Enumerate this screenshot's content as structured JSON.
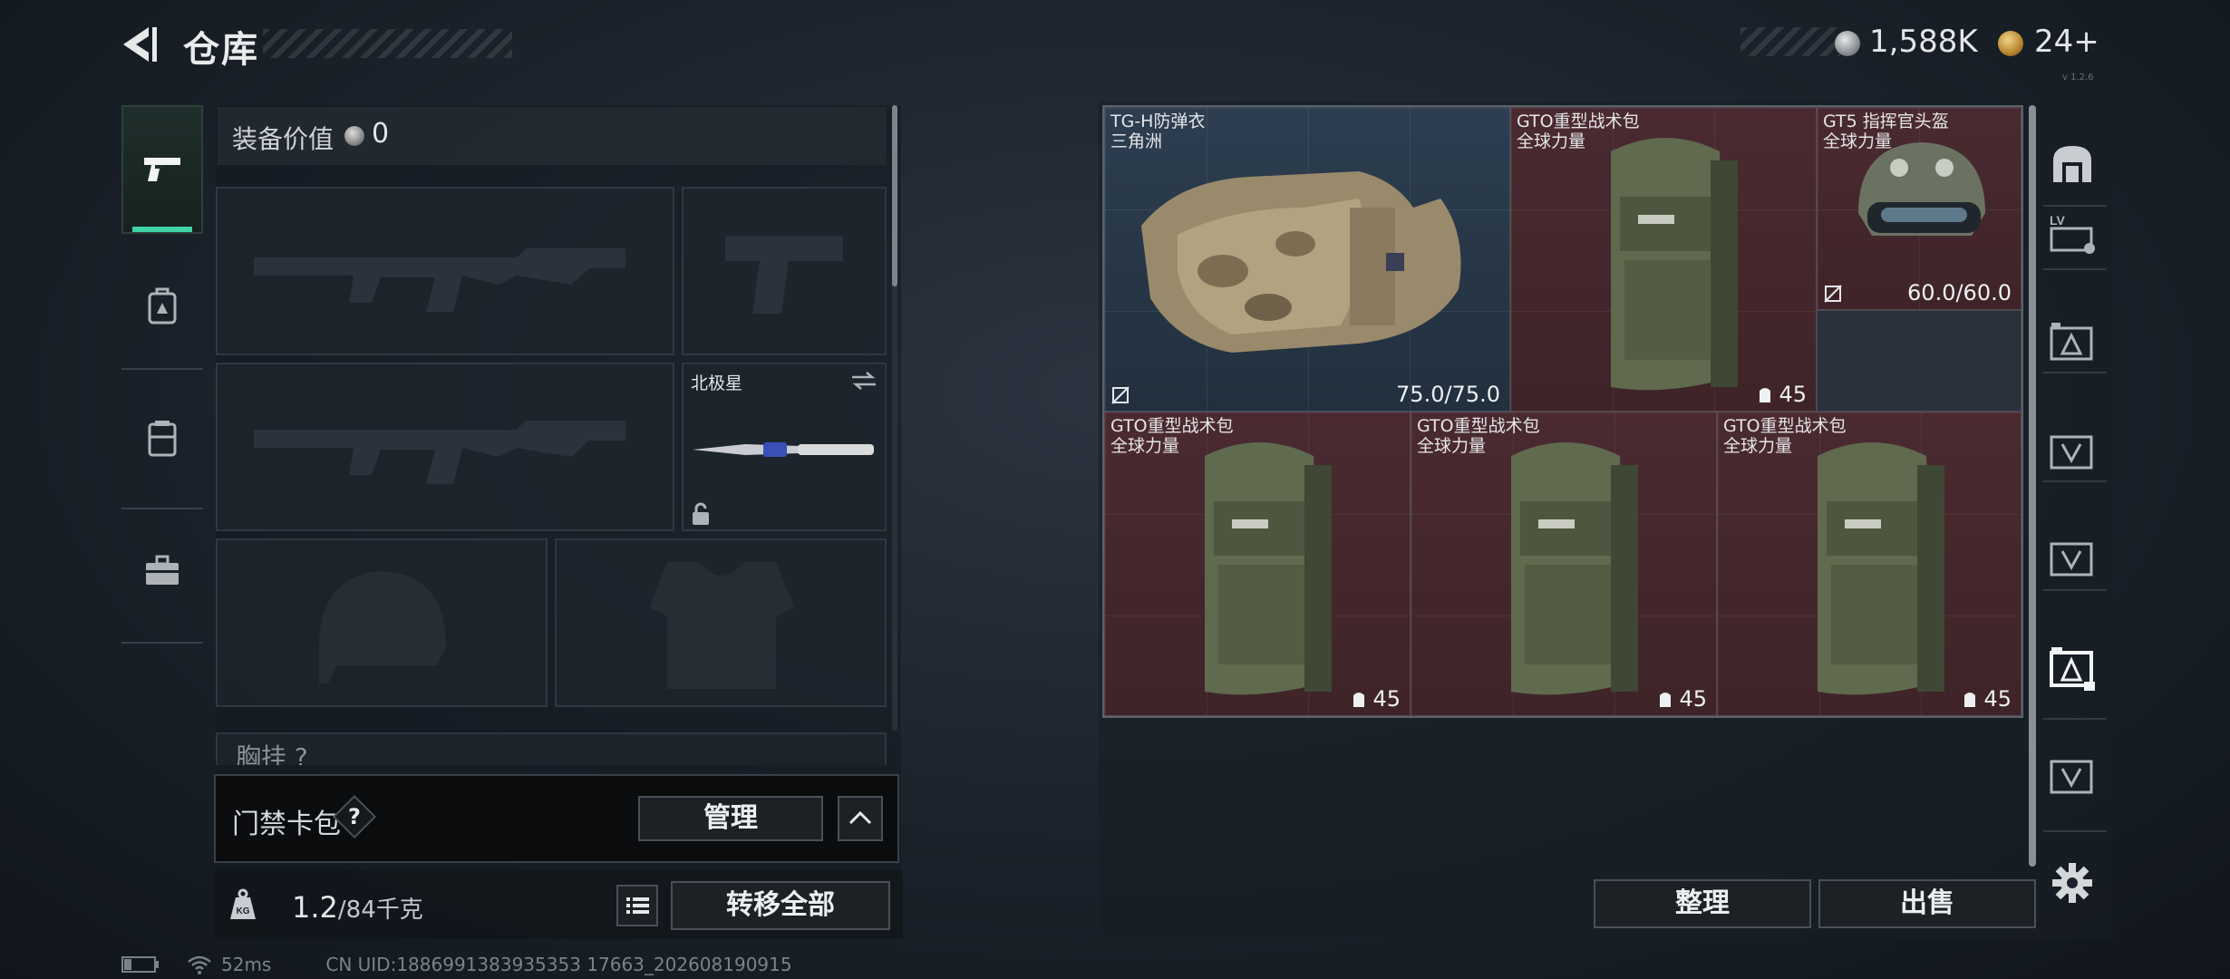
{
  "header": {
    "title": "仓库"
  },
  "currency": {
    "primary_amount": "1,588K",
    "secondary_amount": "24+",
    "version_text": "v 1.2.6"
  },
  "left_tabs": [
    {
      "icon": "pistol-icon",
      "active": true
    },
    {
      "icon": "backpack-icon",
      "active": false
    },
    {
      "icon": "vest-icon",
      "active": false
    },
    {
      "icon": "briefcase-icon",
      "active": false
    }
  ],
  "loadout": {
    "value_label": "装备价值",
    "value_amount": "0",
    "slots": [
      {
        "id": "primary-weapon-1",
        "icon": "rifle-silhouette-icon"
      },
      {
        "id": "sidearm",
        "icon": "pistol-silhouette-icon"
      },
      {
        "id": "primary-weapon-2",
        "icon": "rifle-silhouette-icon"
      },
      {
        "id": "melee",
        "label": "北极星",
        "icon": "knife-icon",
        "locked": true
      },
      {
        "id": "helmet",
        "icon": "helmet-silhouette-icon"
      },
      {
        "id": "armor",
        "icon": "vest-silhouette-icon"
      }
    ],
    "chest_label": "胸挂 ?"
  },
  "keycard": {
    "label": "门禁卡包",
    "help": "?",
    "manage_label": "管理"
  },
  "bottom": {
    "weight_current": "1.2",
    "weight_max": "/84千克",
    "transfer_label": "转移全部"
  },
  "status": {
    "ping": "52ms",
    "uid": "CN UID:1886991383935353 17663_202608190915"
  },
  "stash": {
    "items": [
      {
        "name": "TG-H防弹衣",
        "sub": "三角洲",
        "stat": "75.0/75.0",
        "theme": "blue",
        "kind": "armor",
        "no_insure": true
      },
      {
        "name": "GTO重型战术包",
        "sub": "全球力量",
        "stat": "45",
        "theme": "red",
        "kind": "backpack"
      },
      {
        "name": "GT5 指挥官头盔",
        "sub": "全球力量",
        "stat": "60.0/60.0",
        "theme": "red",
        "kind": "helmet",
        "no_insure": true
      },
      {
        "name": "GTO重型战术包",
        "sub": "全球力量",
        "stat": "45",
        "theme": "red",
        "kind": "backpack"
      },
      {
        "name": "GTO重型战术包",
        "sub": "全球力量",
        "stat": "45",
        "theme": "red",
        "kind": "backpack"
      },
      {
        "name": "GTO重型战术包",
        "sub": "全球力量",
        "stat": "45",
        "theme": "red",
        "kind": "backpack"
      }
    ],
    "sort_label": "整理",
    "sell_label": "出售"
  },
  "right_tabs": [
    {
      "icon": "stash-home-icon",
      "active": false
    },
    {
      "icon": "lv-container-icon",
      "active": false
    },
    {
      "icon": "container-a-icon",
      "active": false
    },
    {
      "icon": "container-v-icon",
      "active": false
    },
    {
      "icon": "container-v-icon",
      "active": false
    },
    {
      "icon": "container-a-icon",
      "active": true
    },
    {
      "icon": "container-v-icon",
      "active": false
    },
    {
      "icon": "gear-icon",
      "active": false
    }
  ],
  "colors": {
    "accent": "#3fd3a6",
    "stash_red": "#42262b",
    "stash_blue": "#2c3e50"
  }
}
